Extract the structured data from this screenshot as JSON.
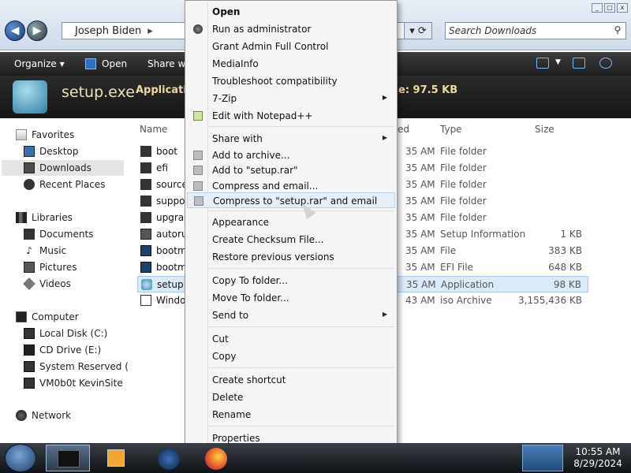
{
  "address": {
    "path": "Joseph Biden",
    "separator": "▸"
  },
  "search": {
    "placeholder": "Search Downloads"
  },
  "toolbar": {
    "organize": "Organize ▾",
    "open": "Open",
    "share": "Share with"
  },
  "details": {
    "filename": "setup.exe",
    "type": "Application",
    "size": "e: 97.5 KB"
  },
  "navpane": {
    "favorites": "Favorites",
    "desktop": "Desktop",
    "downloads": "Downloads",
    "recent": "Recent Places",
    "libraries": "Libraries",
    "documents": "Documents",
    "music": "Music",
    "pictures": "Pictures",
    "videos": "Videos",
    "computer": "Computer",
    "local_disk": "Local Disk (C:)",
    "cd_drive": "CD Drive (E:)",
    "system_reserved": "System Reserved (F:)",
    "vm": "VM0b0t KevinSite",
    "network": "Network"
  },
  "columns": {
    "name": "Name",
    "date": "ed",
    "type": "Type",
    "size": "Size"
  },
  "files": [
    {
      "name": "boot",
      "date": "35 AM",
      "type": "File folder",
      "size": ""
    },
    {
      "name": "efi",
      "date": "35 AM",
      "type": "File folder",
      "size": ""
    },
    {
      "name": "source",
      "date": "35 AM",
      "type": "File folder",
      "size": ""
    },
    {
      "name": "suppor",
      "date": "35 AM",
      "type": "File folder",
      "size": ""
    },
    {
      "name": "upgrac",
      "date": "35 AM",
      "type": "File folder",
      "size": ""
    },
    {
      "name": "autoru",
      "date": "35 AM",
      "type": "Setup Information",
      "size": "1 KB"
    },
    {
      "name": "bootm",
      "date": "35 AM",
      "type": "File",
      "size": "383 KB"
    },
    {
      "name": "bootm",
      "date": "35 AM",
      "type": "EFI File",
      "size": "648 KB"
    },
    {
      "name": "setup.e",
      "date": "35 AM",
      "type": "Application",
      "size": "98 KB"
    },
    {
      "name": "Windo",
      "date": "43 AM",
      "type": "iso Archive",
      "size": "3,155,436 KB"
    }
  ],
  "menu": {
    "open": "Open",
    "run_admin": "Run as administrator",
    "grant_admin": "Grant Admin Full Control",
    "mediainfo": "MediaInfo",
    "troubleshoot": "Troubleshoot compatibility",
    "sevenzip": "7-Zip",
    "notepadpp": "Edit with Notepad++",
    "share_with": "Share with",
    "add_archive": "Add to archive...",
    "add_rar": "Add to \"setup.rar\"",
    "compress_email": "Compress and email...",
    "compress_rar_email": "Compress to \"setup.rar\" and email",
    "appearance": "Appearance",
    "checksum": "Create Checksum File...",
    "restore": "Restore previous versions",
    "copy_to": "Copy To folder...",
    "move_to": "Move To folder...",
    "send_to": "Send to",
    "cut": "Cut",
    "copy": "Copy",
    "create_shortcut": "Create shortcut",
    "delete": "Delete",
    "rename": "Rename",
    "properties": "Properties",
    "submenu_arrow": "▶"
  },
  "taskbar": {
    "time": "10:55 AM",
    "date": "8/29/2024"
  }
}
